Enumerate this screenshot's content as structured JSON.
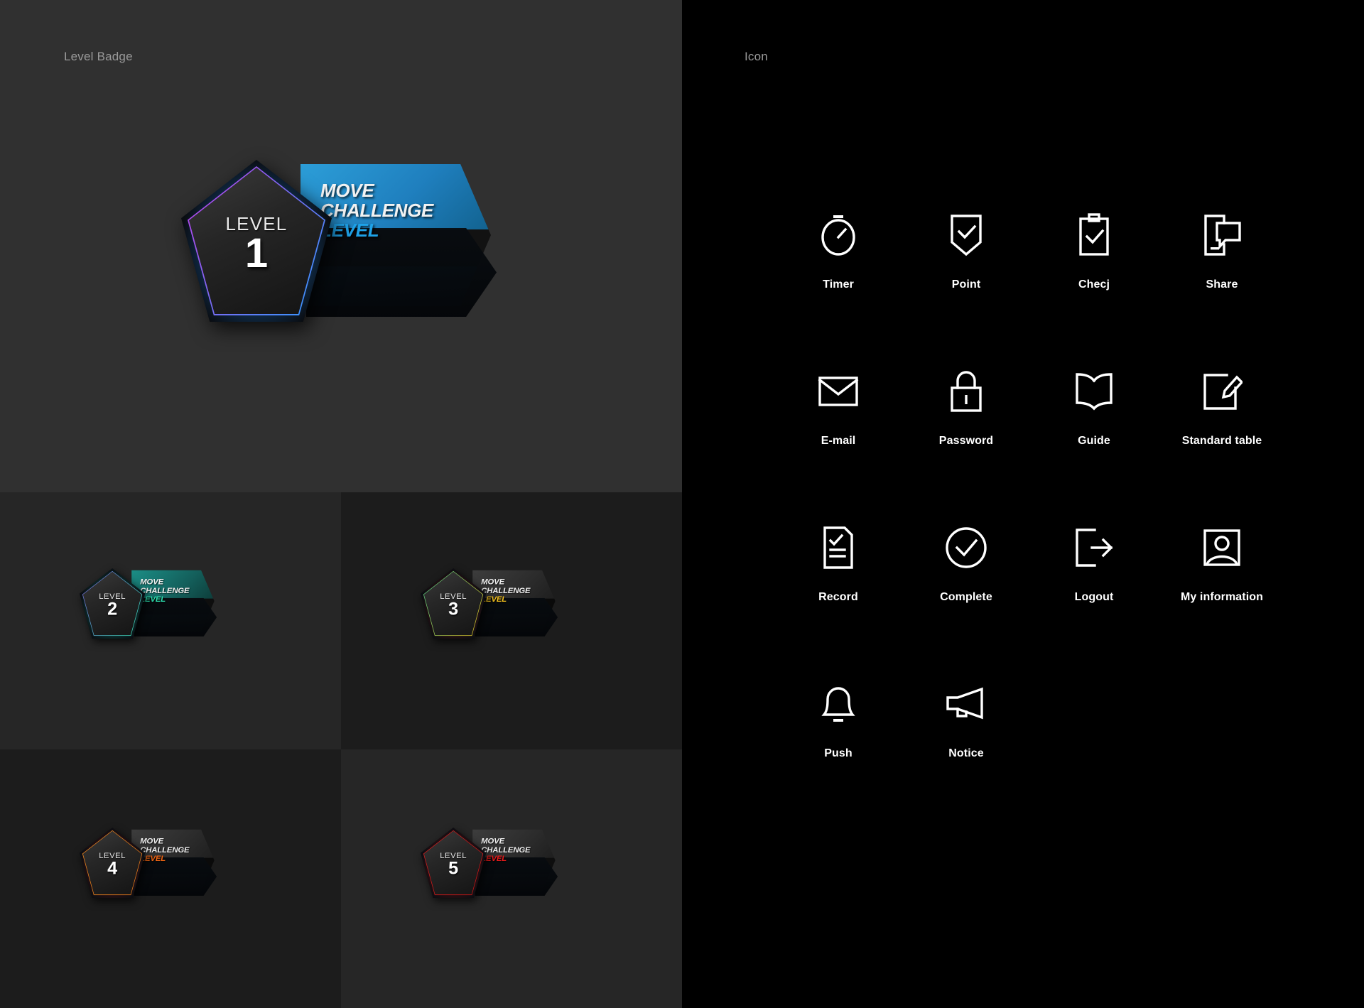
{
  "left_panel": {
    "title": "Level Badge",
    "background": "#303030",
    "badges": [
      {
        "level_word": "LEVEL",
        "level_number": "1",
        "ribbon_line1": "MOVE",
        "ribbon_line2": "CHALLENGE",
        "ribbon_line3": "LEVEL",
        "accent_color": "#2699d6",
        "accent_color_2": "#1ea2e8",
        "border_from": "#c23ce8",
        "border_to": "#2f9bff",
        "glow_color": "#1a6fbf",
        "ribbon_top_gradient": "linear-gradient(135deg, #2c9ed8 0%, #1f7fbe 55%, #12628f 100%)",
        "ribbon_bottom_gradient": "linear-gradient(135deg, #1f82bb 0%, #15628f 60%, #0d3f5d 100%)",
        "size": "large"
      },
      {
        "level_word": "LEVEL",
        "level_number": "2",
        "ribbon_line1": "MOVE",
        "ribbon_line2": "CHALLENGE",
        "ribbon_line3": "LEVEL",
        "accent_color": "#2ee0b0",
        "accent_color_2": "#2ee0b0",
        "border_from": "#7a5cd6",
        "border_to": "#33e6b4",
        "glow_color": "#0e6f60",
        "ribbon_top_gradient": "linear-gradient(135deg, #1b8e86 0%, #14605c 60%, #0d3d3a 100%)",
        "ribbon_bottom_gradient": "linear-gradient(135deg, #12615c 0%, #0c3b39 60%, #061f1e 100%)",
        "size": "small"
      },
      {
        "level_word": "LEVEL",
        "level_number": "3",
        "ribbon_line1": "MOVE",
        "ribbon_line2": "CHALLENGE",
        "ribbon_line3": "LEVEL",
        "accent_color": "#f4c11f",
        "accent_color_2": "#f4c11f",
        "border_from": "#44c98a",
        "border_to": "#e8c01e",
        "glow_color": "#5e1414",
        "ribbon_top_gradient": "linear-gradient(135deg, #3d3d3d 0%, #2c2c2c 60%, #1e1e1e 100%)",
        "ribbon_bottom_gradient": "linear-gradient(135deg, #2a2a2a 0%, #1b1b1b 60%, #101010 100%)",
        "size": "small"
      },
      {
        "level_word": "LEVEL",
        "level_number": "4",
        "ribbon_line1": "MOVE",
        "ribbon_line2": "CHALLENGE",
        "ribbon_line3": "LEVEL",
        "accent_color": "#f06513",
        "accent_color_2": "#f06513",
        "border_from": "#f0891e",
        "border_to": "#e0741a",
        "glow_color": "#601515",
        "ribbon_top_gradient": "linear-gradient(135deg, #3d3d3d 0%, #2c2c2c 60%, #1e1e1e 100%)",
        "ribbon_bottom_gradient": "linear-gradient(135deg, #2a2a2a 0%, #1b1b1b 60%, #101010 100%)",
        "size": "small"
      },
      {
        "level_word": "LEVEL",
        "level_number": "5",
        "ribbon_line1": "MOVE",
        "ribbon_line2": "CHALLENGE",
        "ribbon_line3": "LEVEL",
        "accent_color": "#e81b1b",
        "accent_color_2": "#e81b1b",
        "border_from": "#d41f1f",
        "border_to": "#c41313",
        "glow_color": "#6d1111",
        "ribbon_top_gradient": "linear-gradient(135deg, #3d3d3d 0%, #2c2c2c 60%, #1e1e1e 100%)",
        "ribbon_bottom_gradient": "linear-gradient(135deg, #2a2a2a 0%, #1b1b1b 60%, #101010 100%)",
        "size": "small"
      }
    ]
  },
  "right_panel": {
    "title": "Icon",
    "background": "#000000",
    "icon_color": "#ffffff",
    "icons": [
      {
        "name": "timer-icon",
        "label": "Timer"
      },
      {
        "name": "point-icon",
        "label": "Point"
      },
      {
        "name": "check-clipboard-icon",
        "label": "Checj"
      },
      {
        "name": "share-icon",
        "label": "Share"
      },
      {
        "name": "email-icon",
        "label": "E-mail"
      },
      {
        "name": "password-lock-icon",
        "label": "Password"
      },
      {
        "name": "guide-book-icon",
        "label": "Guide"
      },
      {
        "name": "standard-table-icon",
        "label": "Standard table"
      },
      {
        "name": "record-icon",
        "label": "Record"
      },
      {
        "name": "complete-icon",
        "label": "Complete"
      },
      {
        "name": "logout-icon",
        "label": "Logout"
      },
      {
        "name": "my-information-icon",
        "label": "My information"
      },
      {
        "name": "push-bell-icon",
        "label": "Push"
      },
      {
        "name": "notice-megaphone-icon",
        "label": "Notice"
      }
    ]
  }
}
